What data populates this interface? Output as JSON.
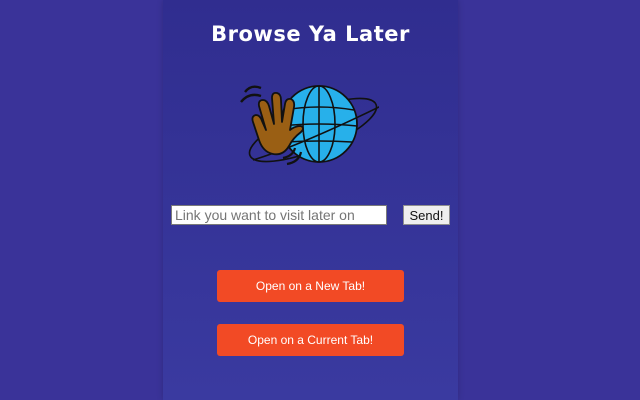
{
  "app": {
    "title": "Browse Ya Later"
  },
  "link_form": {
    "placeholder": "Link you want to visit later on",
    "value": "",
    "send_label": "Send!"
  },
  "actions": {
    "open_new_tab_label": "Open on a New Tab!",
    "open_current_tab_label": "Open on a Current Tab!"
  },
  "logo": {
    "icon": "waving-hand-globe-icon"
  },
  "colors": {
    "page_background": "#3a3399",
    "panel_background": "#302d8f",
    "action_button": "#f24a25",
    "globe": "#27b0ea",
    "hand": "#9a5f14"
  }
}
